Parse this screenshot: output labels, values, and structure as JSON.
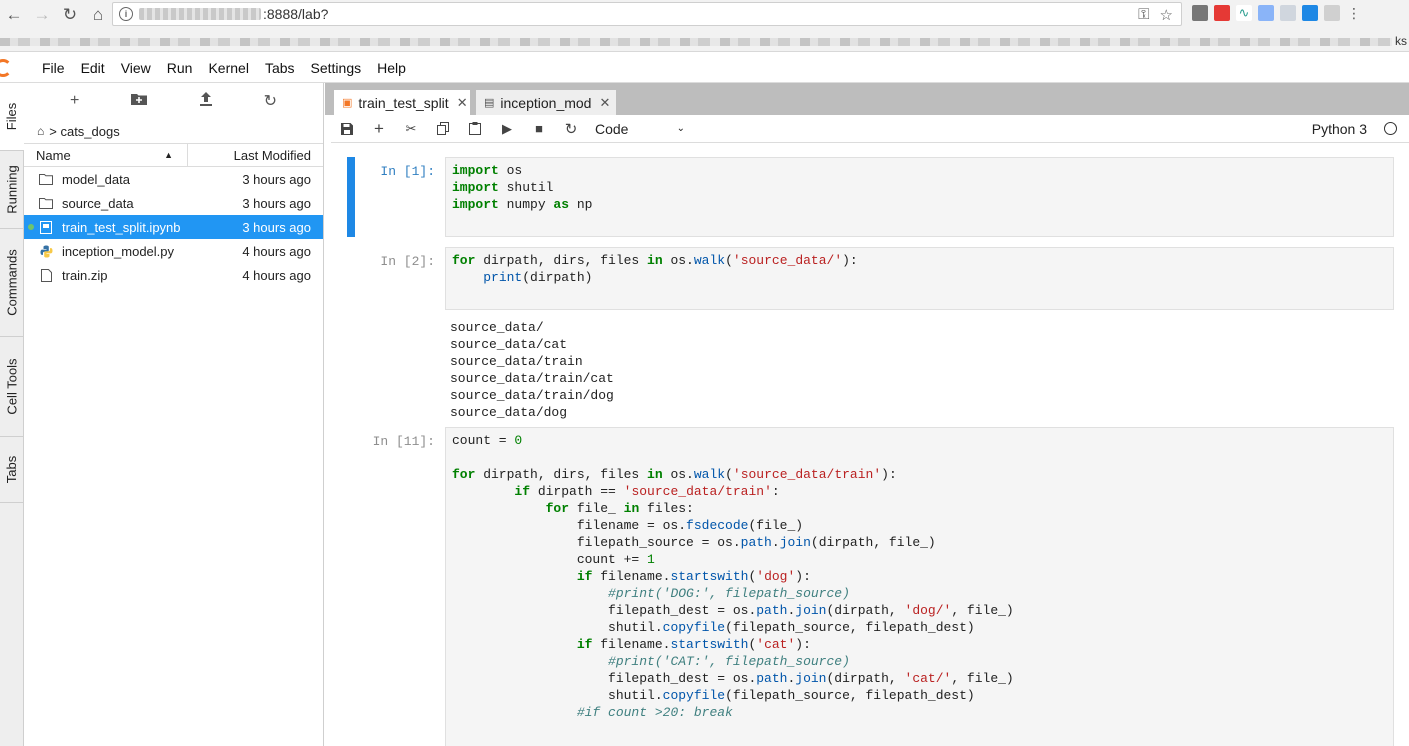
{
  "browser": {
    "url_suffix": ":8888/lab?",
    "bookmarks_trailing": "ks"
  },
  "menubar": [
    "File",
    "Edit",
    "View",
    "Run",
    "Kernel",
    "Tabs",
    "Settings",
    "Help"
  ],
  "side_tabs": [
    "Files",
    "Running",
    "Commands",
    "Cell Tools",
    "Tabs"
  ],
  "filebrowser": {
    "breadcrumb": "cats_dogs",
    "col_name": "Name",
    "col_modified": "Last Modified",
    "files": [
      {
        "name": "model_data",
        "modified": "3 hours ago",
        "type": "folder"
      },
      {
        "name": "source_data",
        "modified": "3 hours ago",
        "type": "folder"
      },
      {
        "name": "train_test_split.ipynb",
        "modified": "3 hours ago",
        "type": "notebook"
      },
      {
        "name": "inception_model.py",
        "modified": "4 hours ago",
        "type": "python"
      },
      {
        "name": "train.zip",
        "modified": "4 hours ago",
        "type": "file"
      }
    ]
  },
  "tabs": [
    {
      "label": "train_test_split"
    },
    {
      "label": "inception_mod"
    }
  ],
  "toolbar": {
    "cell_type": "Code",
    "kernel": "Python 3"
  },
  "cells": [
    {
      "prompt": "In [1]:",
      "lines": [
        "import os",
        "import shutil",
        "import numpy as np"
      ]
    },
    {
      "prompt": "In [2]:",
      "lines": [
        "for dirpath, dirs, files in os.walk('source_data/'):",
        "    print(dirpath)"
      ],
      "output": [
        "source_data/",
        "source_data/cat",
        "source_data/train",
        "source_data/train/cat",
        "source_data/train/dog",
        "source_data/dog"
      ]
    },
    {
      "prompt": "In [11]:",
      "lines": [
        "count = 0",
        "",
        "for dirpath, dirs, files in os.walk('source_data/train'):",
        "        if dirpath == 'source_data/train':",
        "            for file_ in files:",
        "                filename = os.fsdecode(file_)",
        "                filepath_source = os.path.join(dirpath, file_)",
        "                count += 1",
        "                if filename.startswith('dog'):",
        "                    #print('DOG:', filepath_source)",
        "                    filepath_dest = os.path.join(dirpath, 'dog/', file_)",
        "                    shutil.copyfile(filepath_source, filepath_dest)",
        "                if filename.startswith('cat'):",
        "                    #print('CAT:', filepath_source)",
        "                    filepath_dest = os.path.join(dirpath, 'cat/', file_)",
        "                    shutil.copyfile(filepath_source, filepath_dest)",
        "                #if count >20: break"
      ]
    }
  ]
}
